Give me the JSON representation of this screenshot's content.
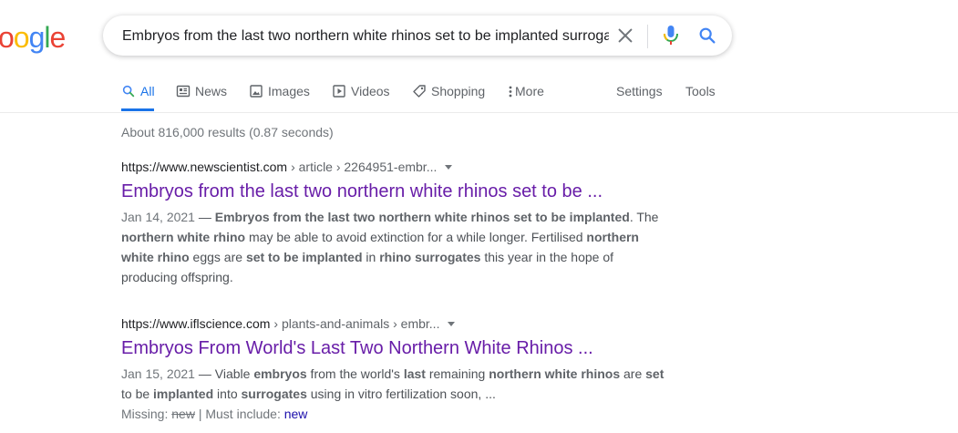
{
  "logo": {
    "text": "oogle"
  },
  "search": {
    "query": "Embryos from the last two northern white rhinos set to be implanted surrogates"
  },
  "tabs": [
    {
      "label": "All",
      "icon": "search-icon"
    },
    {
      "label": "News",
      "icon": "news-icon"
    },
    {
      "label": "Images",
      "icon": "image-icon"
    },
    {
      "label": "Videos",
      "icon": "video-icon"
    },
    {
      "label": "Shopping",
      "icon": "tag-icon"
    },
    {
      "label": "More",
      "icon": "more-vert-icon"
    }
  ],
  "tools": {
    "settings": "Settings",
    "tools": "Tools"
  },
  "stats": "About 816,000 results (0.87 seconds)",
  "results": [
    {
      "domain": "https://www.newscientist.com",
      "path": "› article › 2264951-embr...",
      "title": "Embryos from the last two northern white rhinos set to be ...",
      "date": "Jan 14, 2021",
      "snippet": [
        {
          "t": "Embryos from the last two northern white rhinos set to be implanted",
          "b": true
        },
        {
          "t": ". The ",
          "b": false
        },
        {
          "t": "northern white rhino",
          "b": true
        },
        {
          "t": " may be able to avoid extinction for a while longer. Fertilised ",
          "b": false
        },
        {
          "t": "northern white rhino",
          "b": true
        },
        {
          "t": " eggs are ",
          "b": false
        },
        {
          "t": "set to be implanted",
          "b": true
        },
        {
          "t": " in ",
          "b": false
        },
        {
          "t": "rhino surrogates",
          "b": true
        },
        {
          "t": " this year in the hope of producing offspring.",
          "b": false
        }
      ]
    },
    {
      "domain": "https://www.iflscience.com",
      "path": "› plants-and-animals › embr...",
      "title": "Embryos From World's Last Two Northern White Rhinos ...",
      "date": "Jan 15, 2021",
      "snippet": [
        {
          "t": "Viable ",
          "b": false
        },
        {
          "t": "embryos",
          "b": true
        },
        {
          "t": " from the world's ",
          "b": false
        },
        {
          "t": "last",
          "b": true
        },
        {
          "t": " remaining ",
          "b": false
        },
        {
          "t": "northern white rhinos",
          "b": true
        },
        {
          "t": " are ",
          "b": false
        },
        {
          "t": "set",
          "b": true
        },
        {
          "t": " to be ",
          "b": false
        },
        {
          "t": "implanted",
          "b": true
        },
        {
          "t": " into ",
          "b": false
        },
        {
          "t": "surrogates",
          "b": true
        },
        {
          "t": " using in vitro fertilization soon, ...",
          "b": false
        }
      ],
      "missing": {
        "label": "Missing:",
        "term": "new",
        "must_label": "| Must include:",
        "must_link": "new"
      }
    }
  ],
  "colors": {
    "accent": "#1a73e8",
    "visited_title": "#681da8",
    "link": "#1a0dab",
    "logo": [
      "#ea4335",
      "#fbbc05",
      "#4285f4",
      "#34a853",
      "#ea4335"
    ]
  }
}
